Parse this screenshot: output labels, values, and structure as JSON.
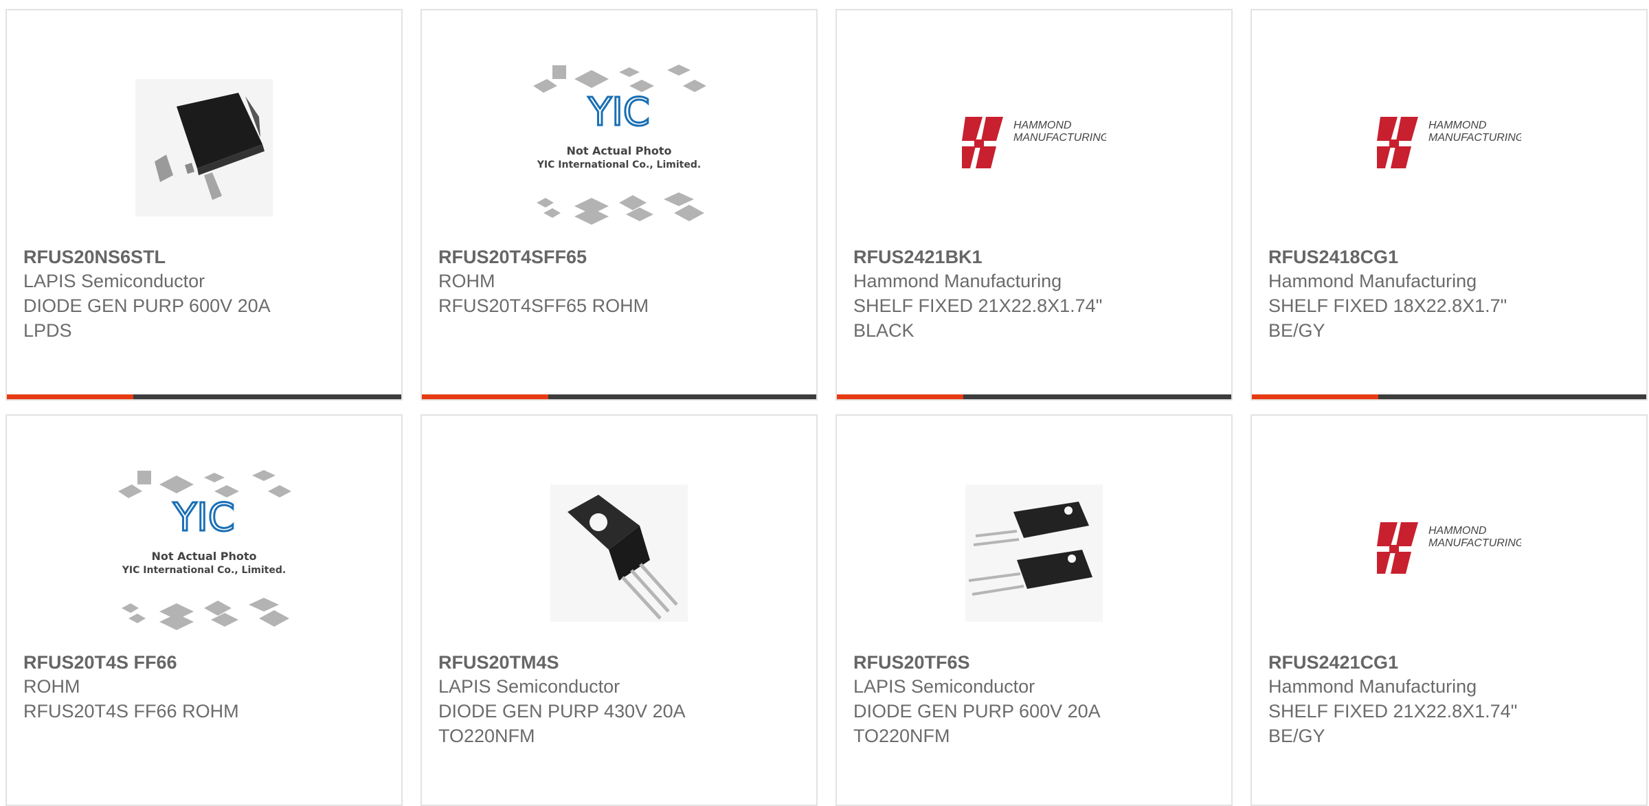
{
  "cards": [
    {
      "part": "RFUS20NS6STL",
      "maker": "LAPIS Semiconductor",
      "desc1": "DIODE GEN PURP 600V 20A",
      "desc2": "LPDS",
      "image": "lpds-package-photo",
      "progress": 0.32
    },
    {
      "part": "RFUS20T4SFF65",
      "maker": "ROHM",
      "desc1": "RFUS20T4SFF65 ROHM",
      "desc2": "",
      "image": "yic-placeholder",
      "progress": 0.32
    },
    {
      "part": "RFUS2421BK1",
      "maker": "Hammond Manufacturing",
      "desc1": "SHELF FIXED 21X22.8X1.74\"",
      "desc2": "BLACK",
      "image": "hammond-logo",
      "progress": 0.32
    },
    {
      "part": "RFUS2418CG1",
      "maker": "Hammond Manufacturing",
      "desc1": "SHELF FIXED 18X22.8X1.7\"",
      "desc2": "BE/GY",
      "image": "hammond-logo",
      "progress": 0.32
    },
    {
      "part": "RFUS20T4S FF66",
      "maker": "ROHM",
      "desc1": "RFUS20T4S FF66 ROHM",
      "desc2": "",
      "image": "yic-placeholder"
    },
    {
      "part": "RFUS20TM4S",
      "maker": "LAPIS Semiconductor",
      "desc1": "DIODE GEN PURP 430V 20A",
      "desc2": "TO220NFM",
      "image": "to220-single-photo"
    },
    {
      "part": "RFUS20TF6S",
      "maker": "LAPIS Semiconductor",
      "desc1": "DIODE GEN PURP 600V 20A",
      "desc2": "TO220NFM",
      "image": "to220-pair-photo"
    },
    {
      "part": "RFUS2421CG1",
      "maker": "Hammond Manufacturing",
      "desc1": "SHELF FIXED 21X22.8X1.74\"",
      "desc2": "BE/GY",
      "image": "hammond-logo"
    }
  ],
  "placeholder": {
    "brand": "YIC",
    "line1": "Not Actual Photo",
    "line2": "YIC International Co., Limited."
  },
  "hammond": {
    "line1": "HAMMOND",
    "line2": "MANUFACTURING."
  },
  "colors": {
    "accent": "#e63b12",
    "bar": "#3c3c3c",
    "hammond_red": "#c8202f",
    "yic_blue": "#1a6fb5"
  }
}
